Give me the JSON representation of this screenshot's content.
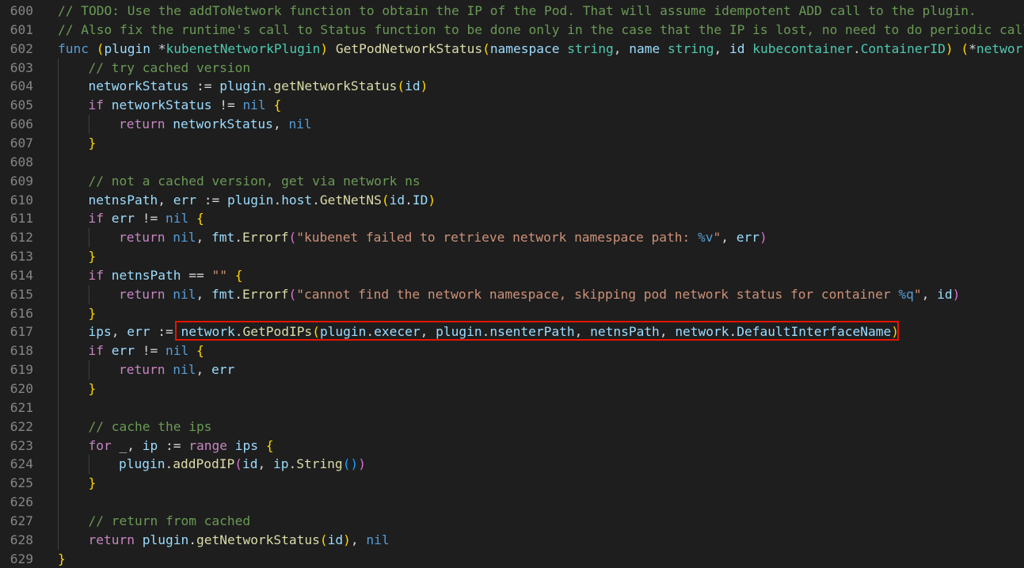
{
  "colors": {
    "background": "#1e1e1e",
    "line_number": "#858585",
    "comment": "#6a9955",
    "keyword": "#569cd6",
    "control": "#c586c0",
    "function": "#dcdcaa",
    "variable": "#9cdcfe",
    "type": "#4ec9b0",
    "string": "#ce9178",
    "bracket_1": "#ffd700",
    "bracket_2": "#da70d6",
    "bracket_3": "#179fff",
    "highlight_box": "#e51400"
  },
  "editor": {
    "lines": [
      {
        "num": "600",
        "indent": 0,
        "tokens": [
          [
            "cmt",
            "// TODO: Use the addToNetwork function to obtain the IP of the Pod. That will assume idempotent ADD call to the plugin."
          ]
        ]
      },
      {
        "num": "601",
        "indent": 0,
        "tokens": [
          [
            "cmt",
            "// Also fix the runtime's call to Status function to be done only in the case that the IP is lost, no need to do periodic calls"
          ]
        ]
      },
      {
        "num": "602",
        "indent": 0,
        "tokens": [
          [
            "kw",
            "func"
          ],
          [
            "op",
            " "
          ],
          [
            "b1",
            "("
          ],
          [
            "var",
            "plugin"
          ],
          [
            "op",
            " *"
          ],
          [
            "type",
            "kubenetNetworkPlugin"
          ],
          [
            "b1",
            ")"
          ],
          [
            "op",
            " "
          ],
          [
            "fn",
            "GetPodNetworkStatus"
          ],
          [
            "b1",
            "("
          ],
          [
            "var",
            "namespace"
          ],
          [
            "op",
            " "
          ],
          [
            "type",
            "string"
          ],
          [
            "op",
            ", "
          ],
          [
            "var",
            "name"
          ],
          [
            "op",
            " "
          ],
          [
            "type",
            "string"
          ],
          [
            "op",
            ", "
          ],
          [
            "var",
            "id"
          ],
          [
            "op",
            " "
          ],
          [
            "type",
            "kubecontainer"
          ],
          [
            "op",
            "."
          ],
          [
            "type",
            "ContainerID"
          ],
          [
            "b1",
            ")"
          ],
          [
            "op",
            " "
          ],
          [
            "b1",
            "("
          ],
          [
            "op",
            "*"
          ],
          [
            "type",
            "network"
          ],
          [
            "op",
            "."
          ]
        ]
      },
      {
        "num": "603",
        "indent": 1,
        "tokens": [
          [
            "cmt",
            "// try cached version"
          ]
        ]
      },
      {
        "num": "604",
        "indent": 1,
        "tokens": [
          [
            "var",
            "networkStatus"
          ],
          [
            "op",
            " := "
          ],
          [
            "var",
            "plugin"
          ],
          [
            "op",
            "."
          ],
          [
            "fn",
            "getNetworkStatus"
          ],
          [
            "b1",
            "("
          ],
          [
            "var",
            "id"
          ],
          [
            "b1",
            ")"
          ]
        ]
      },
      {
        "num": "605",
        "indent": 1,
        "tokens": [
          [
            "ctl",
            "if"
          ],
          [
            "op",
            " "
          ],
          [
            "var",
            "networkStatus"
          ],
          [
            "op",
            " != "
          ],
          [
            "kw",
            "nil"
          ],
          [
            "op",
            " "
          ],
          [
            "b1",
            "{"
          ]
        ]
      },
      {
        "num": "606",
        "indent": 2,
        "tokens": [
          [
            "ctl",
            "return"
          ],
          [
            "op",
            " "
          ],
          [
            "var",
            "networkStatus"
          ],
          [
            "op",
            ", "
          ],
          [
            "kw",
            "nil"
          ]
        ]
      },
      {
        "num": "607",
        "indent": 1,
        "tokens": [
          [
            "b1",
            "}"
          ]
        ]
      },
      {
        "num": "608",
        "indent": 0,
        "tokens": []
      },
      {
        "num": "609",
        "indent": 1,
        "tokens": [
          [
            "cmt",
            "// not a cached version, get via network ns"
          ]
        ]
      },
      {
        "num": "610",
        "indent": 1,
        "tokens": [
          [
            "var",
            "netnsPath"
          ],
          [
            "op",
            ", "
          ],
          [
            "var",
            "err"
          ],
          [
            "op",
            " := "
          ],
          [
            "var",
            "plugin"
          ],
          [
            "op",
            "."
          ],
          [
            "var",
            "host"
          ],
          [
            "op",
            "."
          ],
          [
            "fn",
            "GetNetNS"
          ],
          [
            "b1",
            "("
          ],
          [
            "var",
            "id"
          ],
          [
            "op",
            "."
          ],
          [
            "var",
            "ID"
          ],
          [
            "b1",
            ")"
          ]
        ]
      },
      {
        "num": "611",
        "indent": 1,
        "tokens": [
          [
            "ctl",
            "if"
          ],
          [
            "op",
            " "
          ],
          [
            "var",
            "err"
          ],
          [
            "op",
            " != "
          ],
          [
            "kw",
            "nil"
          ],
          [
            "op",
            " "
          ],
          [
            "b1",
            "{"
          ]
        ]
      },
      {
        "num": "612",
        "indent": 2,
        "tokens": [
          [
            "ctl",
            "return"
          ],
          [
            "op",
            " "
          ],
          [
            "kw",
            "nil"
          ],
          [
            "op",
            ", "
          ],
          [
            "var",
            "fmt"
          ],
          [
            "op",
            "."
          ],
          [
            "fn",
            "Errorf"
          ],
          [
            "b2",
            "("
          ],
          [
            "str",
            "\"kubenet failed to retrieve network namespace path: "
          ],
          [
            "esc",
            "%v"
          ],
          [
            "str",
            "\""
          ],
          [
            "op",
            ", "
          ],
          [
            "var",
            "err"
          ],
          [
            "b2",
            ")"
          ]
        ]
      },
      {
        "num": "613",
        "indent": 1,
        "tokens": [
          [
            "b1",
            "}"
          ]
        ]
      },
      {
        "num": "614",
        "indent": 1,
        "tokens": [
          [
            "ctl",
            "if"
          ],
          [
            "op",
            " "
          ],
          [
            "var",
            "netnsPath"
          ],
          [
            "op",
            " == "
          ],
          [
            "str",
            "\"\""
          ],
          [
            "op",
            " "
          ],
          [
            "b1",
            "{"
          ]
        ]
      },
      {
        "num": "615",
        "indent": 2,
        "tokens": [
          [
            "ctl",
            "return"
          ],
          [
            "op",
            " "
          ],
          [
            "kw",
            "nil"
          ],
          [
            "op",
            ", "
          ],
          [
            "var",
            "fmt"
          ],
          [
            "op",
            "."
          ],
          [
            "fn",
            "Errorf"
          ],
          [
            "b2",
            "("
          ],
          [
            "str",
            "\"cannot find the network namespace, skipping pod network status for container "
          ],
          [
            "esc",
            "%q"
          ],
          [
            "str",
            "\""
          ],
          [
            "op",
            ", "
          ],
          [
            "var",
            "id"
          ],
          [
            "b2",
            ")"
          ]
        ]
      },
      {
        "num": "616",
        "indent": 1,
        "tokens": [
          [
            "b1",
            "}"
          ]
        ]
      },
      {
        "num": "617",
        "indent": 1,
        "tokens": [
          [
            "var",
            "ips"
          ],
          [
            "op",
            ", "
          ],
          [
            "var",
            "err"
          ],
          [
            "op",
            " := "
          ],
          [
            "var",
            "network"
          ],
          [
            "op",
            "."
          ],
          [
            "fn",
            "GetPodIPs"
          ],
          [
            "b1",
            "("
          ],
          [
            "var",
            "plugin"
          ],
          [
            "op",
            "."
          ],
          [
            "var",
            "execer"
          ],
          [
            "op",
            ", "
          ],
          [
            "var",
            "plugin"
          ],
          [
            "op",
            "."
          ],
          [
            "var",
            "nsenterPath"
          ],
          [
            "op",
            ", "
          ],
          [
            "var",
            "netnsPath"
          ],
          [
            "op",
            ", "
          ],
          [
            "var",
            "network"
          ],
          [
            "op",
            "."
          ],
          [
            "var",
            "DefaultInterfaceName"
          ],
          [
            "b1",
            ")"
          ]
        ]
      },
      {
        "num": "618",
        "indent": 1,
        "tokens": [
          [
            "ctl",
            "if"
          ],
          [
            "op",
            " "
          ],
          [
            "var",
            "err"
          ],
          [
            "op",
            " != "
          ],
          [
            "kw",
            "nil"
          ],
          [
            "op",
            " "
          ],
          [
            "b1",
            "{"
          ]
        ]
      },
      {
        "num": "619",
        "indent": 2,
        "tokens": [
          [
            "ctl",
            "return"
          ],
          [
            "op",
            " "
          ],
          [
            "kw",
            "nil"
          ],
          [
            "op",
            ", "
          ],
          [
            "var",
            "err"
          ]
        ]
      },
      {
        "num": "620",
        "indent": 1,
        "tokens": [
          [
            "b1",
            "}"
          ]
        ]
      },
      {
        "num": "621",
        "indent": 0,
        "tokens": []
      },
      {
        "num": "622",
        "indent": 1,
        "tokens": [
          [
            "cmt",
            "// cache the ips"
          ]
        ]
      },
      {
        "num": "623",
        "indent": 1,
        "tokens": [
          [
            "ctl",
            "for"
          ],
          [
            "op",
            " _, "
          ],
          [
            "var",
            "ip"
          ],
          [
            "op",
            " := "
          ],
          [
            "ctl",
            "range"
          ],
          [
            "op",
            " "
          ],
          [
            "var",
            "ips"
          ],
          [
            "op",
            " "
          ],
          [
            "b1",
            "{"
          ]
        ]
      },
      {
        "num": "624",
        "indent": 2,
        "tokens": [
          [
            "var",
            "plugin"
          ],
          [
            "op",
            "."
          ],
          [
            "fn",
            "addPodIP"
          ],
          [
            "b2",
            "("
          ],
          [
            "var",
            "id"
          ],
          [
            "op",
            ", "
          ],
          [
            "var",
            "ip"
          ],
          [
            "op",
            "."
          ],
          [
            "fn",
            "String"
          ],
          [
            "b3",
            "()"
          ],
          [
            "b2",
            ")"
          ]
        ]
      },
      {
        "num": "625",
        "indent": 1,
        "tokens": [
          [
            "b1",
            "}"
          ]
        ]
      },
      {
        "num": "626",
        "indent": 0,
        "tokens": []
      },
      {
        "num": "627",
        "indent": 1,
        "tokens": [
          [
            "cmt",
            "// return from cached"
          ]
        ]
      },
      {
        "num": "628",
        "indent": 1,
        "tokens": [
          [
            "ctl",
            "return"
          ],
          [
            "op",
            " "
          ],
          [
            "var",
            "plugin"
          ],
          [
            "op",
            "."
          ],
          [
            "fn",
            "getNetworkStatus"
          ],
          [
            "b1",
            "("
          ],
          [
            "var",
            "id"
          ],
          [
            "b1",
            ")"
          ],
          [
            "op",
            ", "
          ],
          [
            "kw",
            "nil"
          ]
        ]
      },
      {
        "num": "629",
        "indent": 0,
        "tokens": [
          [
            "b1",
            "}"
          ]
        ]
      }
    ]
  }
}
